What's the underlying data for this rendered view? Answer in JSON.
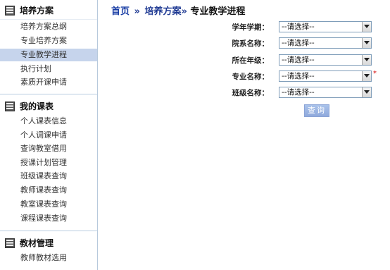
{
  "sidebar": {
    "sections": [
      {
        "title": "培养方案",
        "items": [
          "培养方案总纲",
          "专业培养方案",
          "专业教学进程",
          "执行计划",
          "素质开课申请"
        ]
      },
      {
        "title": "我的课表",
        "items": [
          "个人课表信息",
          "个人调课申请",
          "查询教室借用",
          "授课计划管理",
          "班级课表查询",
          "教师课表查询",
          "教室课表查询",
          "课程课表查询"
        ]
      },
      {
        "title": "教材管理",
        "items": [
          "教师教材选用"
        ]
      }
    ],
    "active_item": "专业教学进程"
  },
  "breadcrumb": {
    "home": "首页",
    "separator1": "»",
    "section": "培养方案»",
    "current": "专业教学进程"
  },
  "form": {
    "fields": [
      {
        "label": "学年学期：",
        "value": "--请选择--",
        "required": false
      },
      {
        "label": "院系名称：",
        "value": "--请选择--",
        "required": false
      },
      {
        "label": "所在年级：",
        "value": "--请选择--",
        "required": false
      },
      {
        "label": "专业名称：",
        "value": "--请选择--",
        "required": true,
        "required_mark": "*"
      },
      {
        "label": "班级名称：",
        "value": "--请选择--",
        "required": false
      }
    ],
    "query_label": "查询"
  },
  "icons": {
    "section_icon": "menu-list-icon",
    "dropdown_icon": "chevron-down-icon"
  },
  "colors": {
    "breadcrumb": "#1f3a93",
    "active_item_bg": "#c6d4ec",
    "button_bg": "#98b1e0",
    "required": "#d40000"
  }
}
